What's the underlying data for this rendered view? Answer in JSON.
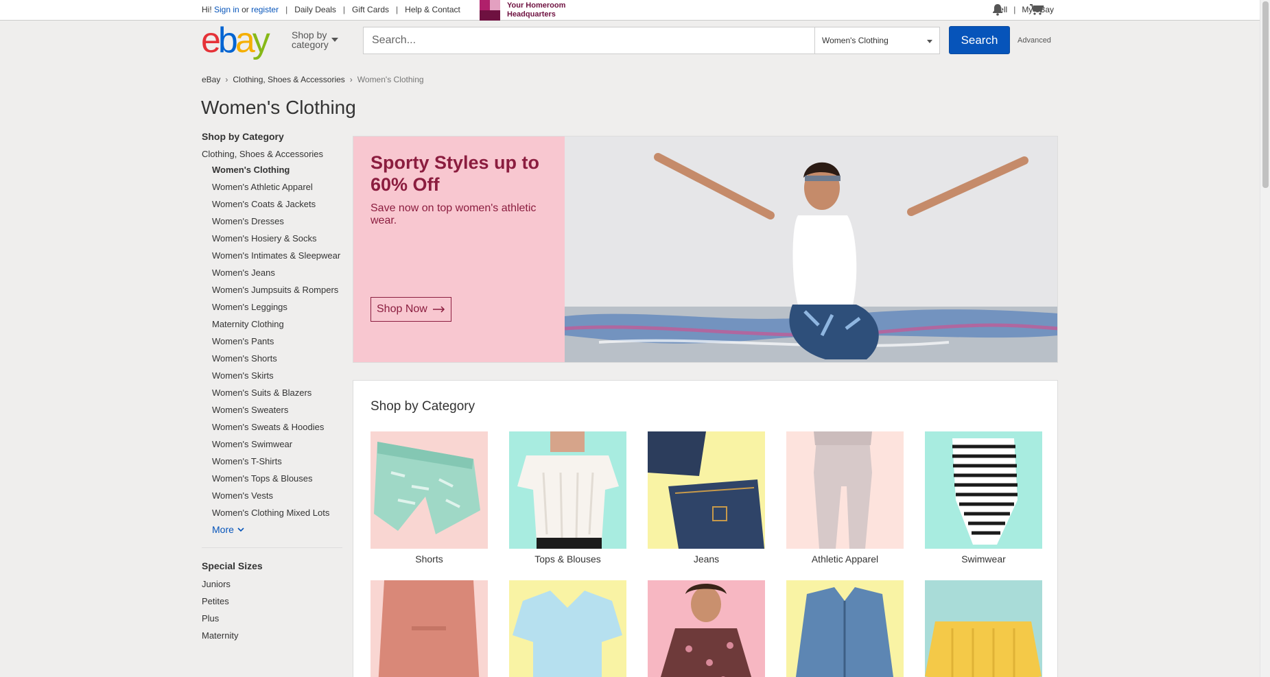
{
  "topbar": {
    "greeting": "Hi!",
    "sign_in": "Sign in",
    "or": "or",
    "register": "register",
    "links": [
      "Daily Deals",
      "Gift Cards",
      "Help & Contact"
    ],
    "promo_line1": "Your Homeroom",
    "promo_line2": "Headquarters",
    "sell": "Sell",
    "my_ebay": "My eBay"
  },
  "header": {
    "logo": [
      "e",
      "b",
      "a",
      "y"
    ],
    "shop_by_line1": "Shop by",
    "shop_by_line2": "category",
    "search_placeholder": "Search...",
    "category_selected": "Women's Clothing",
    "search_button": "Search",
    "advanced": "Advanced"
  },
  "breadcrumb": [
    "eBay",
    "Clothing, Shoes & Accessories",
    "Women's Clothing"
  ],
  "page_title": "Women's Clothing",
  "sidebar": {
    "heading": "Shop by Category",
    "parent": "Clothing, Shoes & Accessories",
    "items": [
      "Women's Clothing",
      "Women's Athletic Apparel",
      "Women's Coats & Jackets",
      "Women's Dresses",
      "Women's Hosiery & Socks",
      "Women's Intimates & Sleepwear",
      "Women's Jeans",
      "Women's Jumpsuits & Rompers",
      "Women's Leggings",
      "Maternity Clothing",
      "Women's Pants",
      "Women's Shorts",
      "Women's Skirts",
      "Women's Suits & Blazers",
      "Women's Sweaters",
      "Women's Sweats & Hoodies",
      "Women's Swimwear",
      "Women's T-Shirts",
      "Women's Tops & Blouses",
      "Women's Vests",
      "Women's Clothing Mixed Lots"
    ],
    "more": "More",
    "sizes_heading": "Special Sizes",
    "sizes": [
      "Juniors",
      "Petites",
      "Plus",
      "Maternity"
    ]
  },
  "hero": {
    "title": "Sporty Styles up to 60% Off",
    "subtitle": "Save now on top women's athletic wear.",
    "cta": "Shop Now"
  },
  "category_grid": {
    "heading": "Shop by Category",
    "tiles": [
      "Shorts",
      "Tops & Blouses",
      "Jeans",
      "Athletic Apparel",
      "Swimwear"
    ]
  },
  "colors": {
    "accent_blue": "#0654ba",
    "hero_pink": "#f8c7d0",
    "hero_text": "#8b1d3f"
  },
  "icons": [
    "bell-icon",
    "cart-icon",
    "caret-down-icon",
    "chevron-right-icon",
    "arrow-right-icon",
    "chevron-down-icon"
  ]
}
